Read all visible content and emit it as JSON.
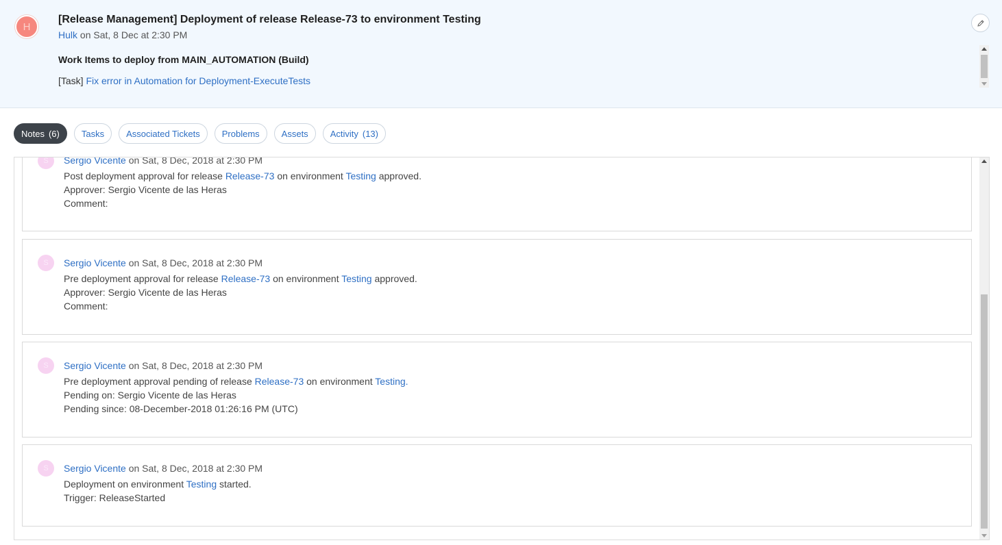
{
  "header": {
    "avatar_initial": "H",
    "title": "[Release Management] Deployment of release Release-73 to environment Testing",
    "author": "Hulk",
    "posted": "on Sat, 8 Dec at 2:30 PM",
    "description": {
      "heading": "Work Items to deploy from MAIN_AUTOMATION (Build)",
      "task_prefix": "[Task]",
      "task_link": "Fix error in Automation for Deployment-ExecuteTests"
    }
  },
  "tabs": [
    {
      "label": "Notes",
      "count": "(6)",
      "active": true
    },
    {
      "label": "Tasks",
      "count": ""
    },
    {
      "label": "Associated Tickets",
      "count": ""
    },
    {
      "label": "Problems",
      "count": ""
    },
    {
      "label": "Assets",
      "count": ""
    },
    {
      "label": "Activity",
      "count": "(13)"
    }
  ],
  "notes": [
    {
      "avatar_initial": "S",
      "author": "Sergio Vicente",
      "posted": "on Sat, 8 Dec, 2018 at 2:30 PM",
      "line1_pre": "Post deployment approval for release",
      "release": "Release-73",
      "line1_mid": "on environment",
      "env": "Testing",
      "line1_post": "approved.",
      "line2": "Approver: Sergio Vicente de las Heras",
      "line3": "Comment:"
    },
    {
      "avatar_initial": "S",
      "author": "Sergio Vicente",
      "posted": "on Sat, 8 Dec, 2018 at 2:30 PM",
      "line1_pre": "Pre deployment approval for release",
      "release": "Release-73",
      "line1_mid": "on environment",
      "env": "Testing",
      "line1_post": "approved.",
      "line2": "Approver: Sergio Vicente de las Heras",
      "line3": "Comment:"
    },
    {
      "avatar_initial": "S",
      "author": "Sergio Vicente",
      "posted": "on Sat, 8 Dec, 2018 at 2:30 PM",
      "line1_pre": "Pre deployment approval pending of release",
      "release": "Release-73",
      "line1_mid": "on environment",
      "env": "Testing.",
      "line1_post": "",
      "line2": "Pending on: Sergio Vicente de las Heras",
      "line3": "Pending since: 08-December-2018 01:26:16 PM (UTC)"
    },
    {
      "avatar_initial": "S",
      "author": "Sergio Vicente",
      "posted": "on Sat, 8 Dec, 2018 at 2:30 PM",
      "line1_pre": "Deployment on environment",
      "env": "Testing",
      "line1_post": "started.",
      "line2": "Trigger: ReleaseStarted"
    }
  ],
  "colors": {
    "link": "#2e6fc4",
    "active_tab": "#3d434a",
    "header_bg": "#f2f8fe",
    "header_avatar": "#f6877e",
    "note_avatar": "#f7d3f1"
  },
  "icons": {
    "edit": "pencil-icon"
  }
}
